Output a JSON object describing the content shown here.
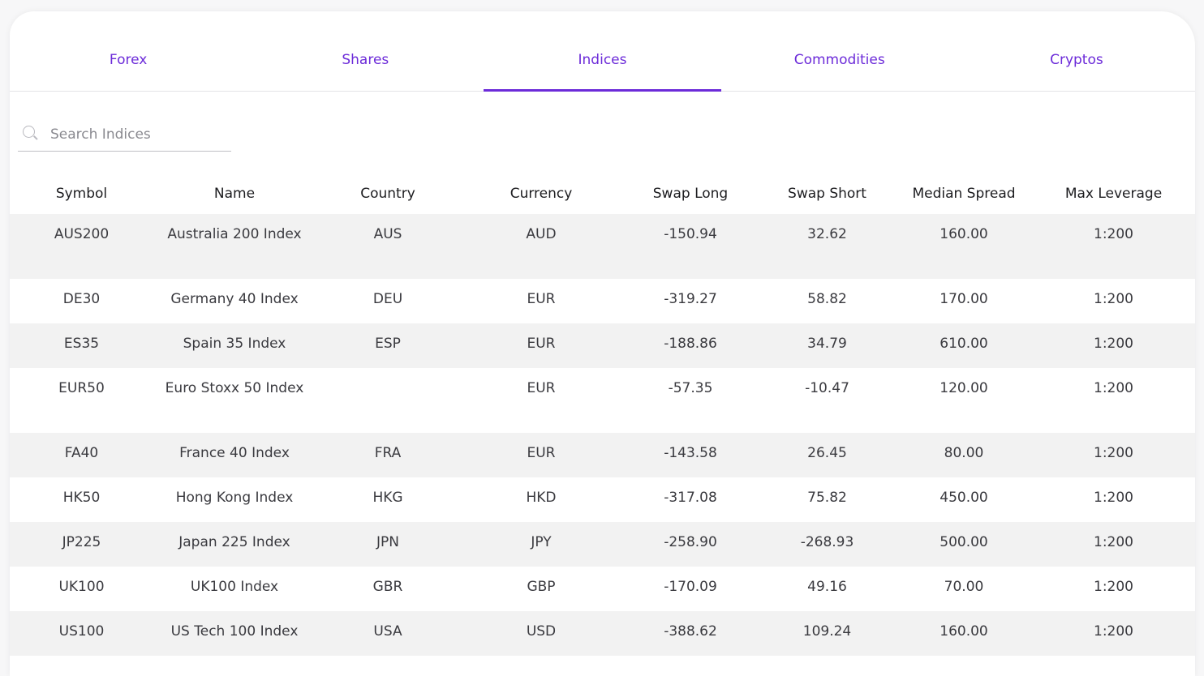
{
  "tabs": [
    {
      "label": "Forex",
      "active": false
    },
    {
      "label": "Shares",
      "active": false
    },
    {
      "label": "Indices",
      "active": true
    },
    {
      "label": "Commodities",
      "active": false
    },
    {
      "label": "Cryptos",
      "active": false
    }
  ],
  "accent_color": "#6c2bd9",
  "search": {
    "placeholder": "Search Indices",
    "value": "",
    "icon": "search-icon"
  },
  "table": {
    "headers": [
      "Symbol",
      "Name",
      "Country",
      "Currency",
      "Swap Long",
      "Swap Short",
      "Median Spread",
      "Max Leverage"
    ],
    "rows": [
      [
        "AUS200",
        "Australia 200 Index",
        "AUS",
        "AUD",
        "-150.94",
        "32.62",
        "160.00",
        "1:200"
      ],
      [
        "DE30",
        "Germany 40 Index",
        "DEU",
        "EUR",
        "-319.27",
        "58.82",
        "170.00",
        "1:200"
      ],
      [
        "ES35",
        "Spain 35 Index",
        "ESP",
        "EUR",
        "-188.86",
        "34.79",
        "610.00",
        "1:200"
      ],
      [
        "EUR50",
        "Euro Stoxx 50 Index",
        "",
        "EUR",
        "-57.35",
        "-10.47",
        "120.00",
        "1:200"
      ],
      [
        "FA40",
        "France 40 Index",
        "FRA",
        "EUR",
        "-143.58",
        "26.45",
        "80.00",
        "1:200"
      ],
      [
        "HK50",
        "Hong Kong Index",
        "HKG",
        "HKD",
        "-317.08",
        "75.82",
        "450.00",
        "1:200"
      ],
      [
        "JP225",
        "Japan 225 Index",
        "JPN",
        "JPY",
        "-258.90",
        "-268.93",
        "500.00",
        "1:200"
      ],
      [
        "UK100",
        "UK100 Index",
        "GBR",
        "GBP",
        "-170.09",
        "49.16",
        "70.00",
        "1:200"
      ],
      [
        "US100",
        "US Tech 100 Index",
        "USA",
        "USD",
        "-388.62",
        "109.24",
        "160.00",
        "1:200"
      ]
    ]
  }
}
